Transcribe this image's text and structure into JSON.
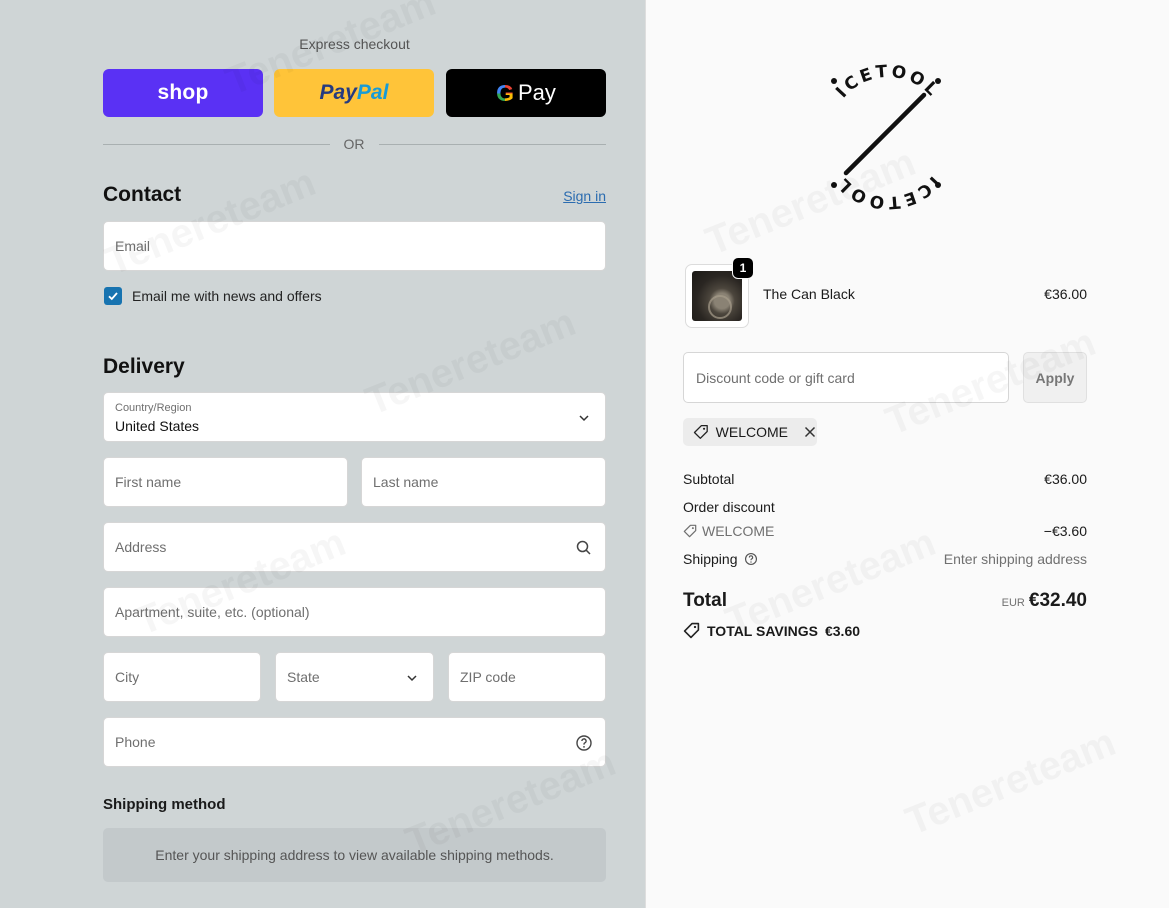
{
  "express": {
    "title": "Express checkout",
    "shop_label": "shop",
    "paypal_part1": "Pay",
    "paypal_part2": "Pal",
    "gpay_g": "G",
    "gpay_label": "Pay",
    "or_label": "OR"
  },
  "contact": {
    "heading": "Contact",
    "signin_label": "Sign in",
    "email_placeholder": "Email",
    "newsletter_label": "Email me with news and offers",
    "newsletter_checked": true
  },
  "delivery": {
    "heading": "Delivery",
    "country_label": "Country/Region",
    "country_value": "United States",
    "first_name_placeholder": "First name",
    "last_name_placeholder": "Last name",
    "address_placeholder": "Address",
    "apartment_placeholder": "Apartment, suite, etc. (optional)",
    "city_placeholder": "City",
    "state_placeholder": "State",
    "zip_placeholder": "ZIP code",
    "phone_placeholder": "Phone"
  },
  "shipping_method": {
    "heading": "Shipping method",
    "message": "Enter your shipping address to view available shipping methods."
  },
  "brand": {
    "logo_text": "ICETOOL"
  },
  "cart": {
    "items": [
      {
        "name": "The Can Black",
        "price": "€36.00",
        "quantity": "1"
      }
    ]
  },
  "discount": {
    "placeholder": "Discount code or gift card",
    "apply_label": "Apply",
    "applied_code": "WELCOME"
  },
  "summary": {
    "subtotal_label": "Subtotal",
    "subtotal_value": "€36.00",
    "order_discount_label": "Order discount",
    "discount_code": "WELCOME",
    "discount_value": "−€3.60",
    "shipping_label": "Shipping",
    "shipping_value": "Enter shipping address",
    "total_label": "Total",
    "total_currency": "EUR",
    "total_value": "€32.40",
    "savings_label": "TOTAL SAVINGS",
    "savings_value": "€3.60"
  },
  "watermark": "Tenereteam",
  "colors": {
    "shop_purple": "#5a31f4",
    "paypal_yellow": "#ffc439",
    "link_blue": "#2b6cb0",
    "checkbox_blue": "#1773b0"
  }
}
